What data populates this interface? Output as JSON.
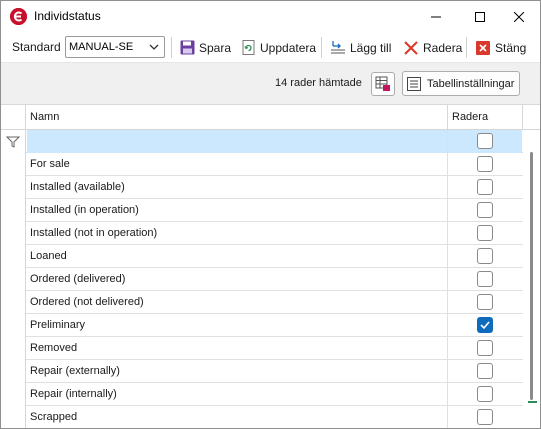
{
  "window": {
    "title": "Individstatus",
    "app_icon": "app-logo-icon",
    "controls": [
      "minimize-icon",
      "maximize-icon",
      "close-icon"
    ]
  },
  "toolbar": {
    "standard_label": "Standard",
    "standard_value": "MANUAL-SE",
    "save_label": "Spara",
    "refresh_label": "Uppdatera",
    "add_label": "Lägg till",
    "delete_label": "Radera",
    "close_label": "Stäng"
  },
  "status": {
    "row_count": "14 rader hämtade",
    "table_settings_label": "Tabellinställningar"
  },
  "grid": {
    "columns": [
      "Namn",
      "Radera"
    ],
    "filter_row": {
      "name": "",
      "radera": false
    },
    "rows": [
      {
        "name": "For sale",
        "radera": false
      },
      {
        "name": "Installed (available)",
        "radera": false
      },
      {
        "name": "Installed (in operation)",
        "radera": false
      },
      {
        "name": "Installed (not in operation)",
        "radera": false
      },
      {
        "name": "Loaned",
        "radera": false
      },
      {
        "name": "Ordered (delivered)",
        "radera": false
      },
      {
        "name": "Ordered (not delivered)",
        "radera": false
      },
      {
        "name": "Preliminary",
        "radera": true
      },
      {
        "name": "Removed",
        "radera": false
      },
      {
        "name": "Repair (externally)",
        "radera": false
      },
      {
        "name": "Repair (internally)",
        "radera": false
      },
      {
        "name": "Scrapped",
        "radera": false
      }
    ]
  },
  "colors": {
    "accent": "#0f6cbd",
    "filter_row": "#cce8ff",
    "brand": "#c8102e"
  }
}
